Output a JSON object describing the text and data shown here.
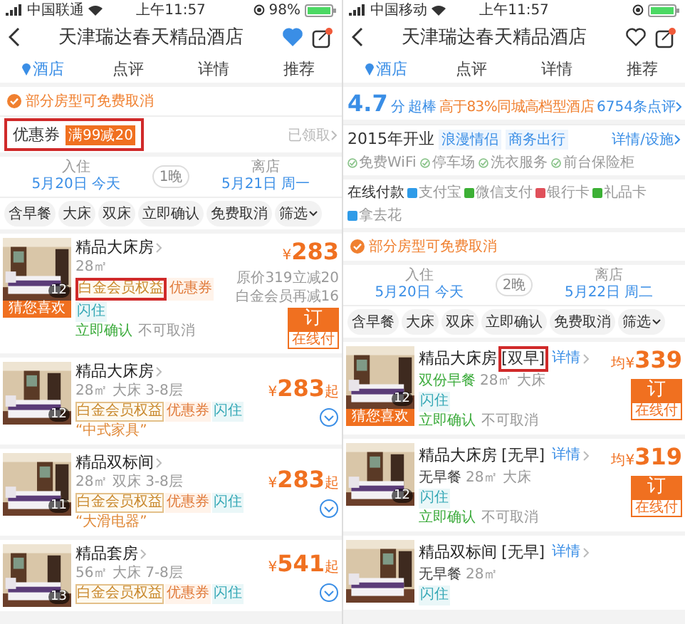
{
  "screens": [
    {
      "status_bar": {
        "carrier": "中国联通",
        "time": "上午11:57",
        "battery": "98%"
      },
      "title": "天津瑞达春天精品酒店",
      "favorited": true,
      "tabs": [
        {
          "label": "酒店",
          "selected": true
        },
        {
          "label": "点评",
          "selected": false
        },
        {
          "label": "详情",
          "selected": false
        },
        {
          "label": "推荐",
          "selected": false
        }
      ],
      "notice": "部分房型可免费取消",
      "coupon": {
        "label": "优惠券",
        "tag": "满99减20",
        "action": "已领取",
        "highlighted": true
      },
      "stay": {
        "checkin_label": "入住",
        "checkin": "5月20日 今天",
        "nights": "1晚",
        "checkout_label": "离店",
        "checkout": "5月21日 周一"
      },
      "filters": [
        "含早餐",
        "大床",
        "双床",
        "立即确认",
        "免费取消",
        "筛选"
      ],
      "rooms": [
        {
          "name": "精品大床房",
          "specs": "28㎡",
          "tags": [
            {
              "label": "白金会员权益",
              "kind": "member",
              "highlighted": true
            },
            {
              "label": "优惠券",
              "kind": "coupon",
              "highlighted": false
            },
            {
              "label": "闪住",
              "kind": "flash",
              "highlighted": false
            }
          ],
          "policy": [
            "立即确认",
            "不可取消"
          ],
          "photo_count": "12",
          "photo_badge": "猜您喜欢",
          "currency": "¥",
          "price": "283",
          "price_notes": [
            "原价319立减20",
            "白金会员再减16"
          ],
          "book": {
            "label": "订",
            "sub": "在线付"
          }
        },
        {
          "name": "精品大床房",
          "specs": "28㎡ 大床 3-8层",
          "tags": [
            {
              "label": "白金会员权益",
              "kind": "member",
              "highlighted": false
            },
            {
              "label": "优惠券",
              "kind": "coupon",
              "highlighted": false
            },
            {
              "label": "闪住",
              "kind": "flash",
              "highlighted": false
            }
          ],
          "quote": "“中式家具”",
          "photo_count": "12",
          "currency": "¥",
          "price": "283",
          "price_suffix": "起",
          "expand": true
        },
        {
          "name": "精品双标间",
          "specs": "28㎡ 双床 3-8层",
          "tags": [
            {
              "label": "白金会员权益",
              "kind": "member",
              "highlighted": false
            },
            {
              "label": "优惠券",
              "kind": "coupon",
              "highlighted": false
            },
            {
              "label": "闪住",
              "kind": "flash",
              "highlighted": false
            }
          ],
          "quote": "“大滑电器”",
          "photo_count": "11",
          "currency": "¥",
          "price": "283",
          "price_suffix": "起",
          "expand": true
        },
        {
          "name": "精品套房",
          "specs": "56㎡ 大床 7-8层",
          "tags": [
            {
              "label": "白金会员权益",
              "kind": "member",
              "highlighted": false
            },
            {
              "label": "优惠券",
              "kind": "coupon",
              "highlighted": false
            },
            {
              "label": "闪住",
              "kind": "flash",
              "highlighted": false
            }
          ],
          "photo_count": "13",
          "currency": "¥",
          "price": "541",
          "price_suffix": "起",
          "expand": true
        }
      ]
    },
    {
      "status_bar": {
        "carrier": "中国移动",
        "time": "上午11:57"
      },
      "title": "天津瑞达春天精品酒店",
      "favorited": false,
      "tabs": [
        {
          "label": "酒店",
          "selected": true
        },
        {
          "label": "点评",
          "selected": false
        },
        {
          "label": "详情",
          "selected": false
        },
        {
          "label": "推荐",
          "selected": false
        }
      ],
      "rating": {
        "score": "4.7",
        "unit": "分",
        "grade": "超棒",
        "comparison": "高于83%同城高档型酒店",
        "reviews": "6754条点评"
      },
      "info": {
        "opened": "2015年开业",
        "themes": [
          "浪漫情侣",
          "商务出行"
        ],
        "link": "详情/设施",
        "amenities": [
          "免费WiFi",
          "停车场",
          "洗衣服务",
          "前台保险柜"
        ]
      },
      "payment": {
        "label": "在线付款",
        "methods": [
          {
            "label": "支付宝",
            "color": "#2e9be8"
          },
          {
            "label": "微信支付",
            "color": "#3cb035"
          },
          {
            "label": "银行卡",
            "color": "#e0505a"
          },
          {
            "label": "礼品卡",
            "color": "#3cb035"
          },
          {
            "label": "拿去花",
            "color": "#2e9be8"
          }
        ]
      },
      "notice": "部分房型可免费取消",
      "stay": {
        "checkin_label": "入住",
        "checkin": "5月20日 今天",
        "nights": "2晚",
        "checkout_label": "离店",
        "checkout": "5月22日 周二"
      },
      "filters": [
        "含早餐",
        "大床",
        "双床",
        "立即确认",
        "免费取消",
        "筛选"
      ],
      "rooms": [
        {
          "name": "精品大床房",
          "suffix": "[双早]",
          "suffix_highlighted": true,
          "detail_link": "详情",
          "meal": {
            "text": "双份早餐",
            "included": true
          },
          "specs": "28㎡ 大床",
          "tags": [
            {
              "label": "闪住",
              "kind": "flash",
              "highlighted": false
            }
          ],
          "policy": [
            "立即确认",
            "不可取消"
          ],
          "photo_count": "12",
          "photo_badge": "猜您喜欢",
          "currency": "均¥",
          "price": "339",
          "book": {
            "label": "订",
            "sub": "在线付"
          }
        },
        {
          "name": "精品大床房",
          "suffix": "[无早]",
          "suffix_highlighted": false,
          "detail_link": "详情",
          "meal": {
            "text": "无早餐",
            "included": false
          },
          "specs": "28㎡ 大床",
          "tags": [
            {
              "label": "闪住",
              "kind": "flash",
              "highlighted": false
            }
          ],
          "policy": [
            "立即确认",
            "不可取消"
          ],
          "photo_count": "12",
          "currency": "均¥",
          "price": "319",
          "book": {
            "label": "订",
            "sub": "在线付"
          }
        },
        {
          "name": "精品双标间",
          "suffix": "[无早]",
          "suffix_highlighted": false,
          "detail_link": "详情",
          "meal": {
            "text": "无早餐",
            "included": false
          },
          "specs": "28㎡",
          "tags": [
            {
              "label": "闪住",
              "kind": "flash",
              "highlighted": false
            }
          ]
        }
      ]
    }
  ]
}
